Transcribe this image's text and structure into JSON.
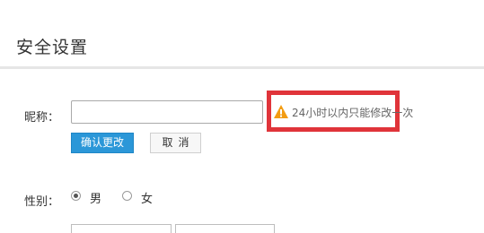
{
  "page": {
    "title": "安全设置"
  },
  "nickname": {
    "label": "昵称：",
    "value": "",
    "placeholder": "",
    "warning": "24小时以内只能修改一次",
    "warning_icon": "warning-triangle-icon",
    "confirm_label": "确认更改",
    "cancel_label": "取消"
  },
  "gender": {
    "label": "性别：",
    "options": [
      {
        "label": "男",
        "selected": true
      },
      {
        "label": "女",
        "selected": false
      }
    ]
  },
  "colors": {
    "accent": "#2b97d8",
    "highlight_border": "#e0343a",
    "warning_icon": "#f39c12"
  }
}
